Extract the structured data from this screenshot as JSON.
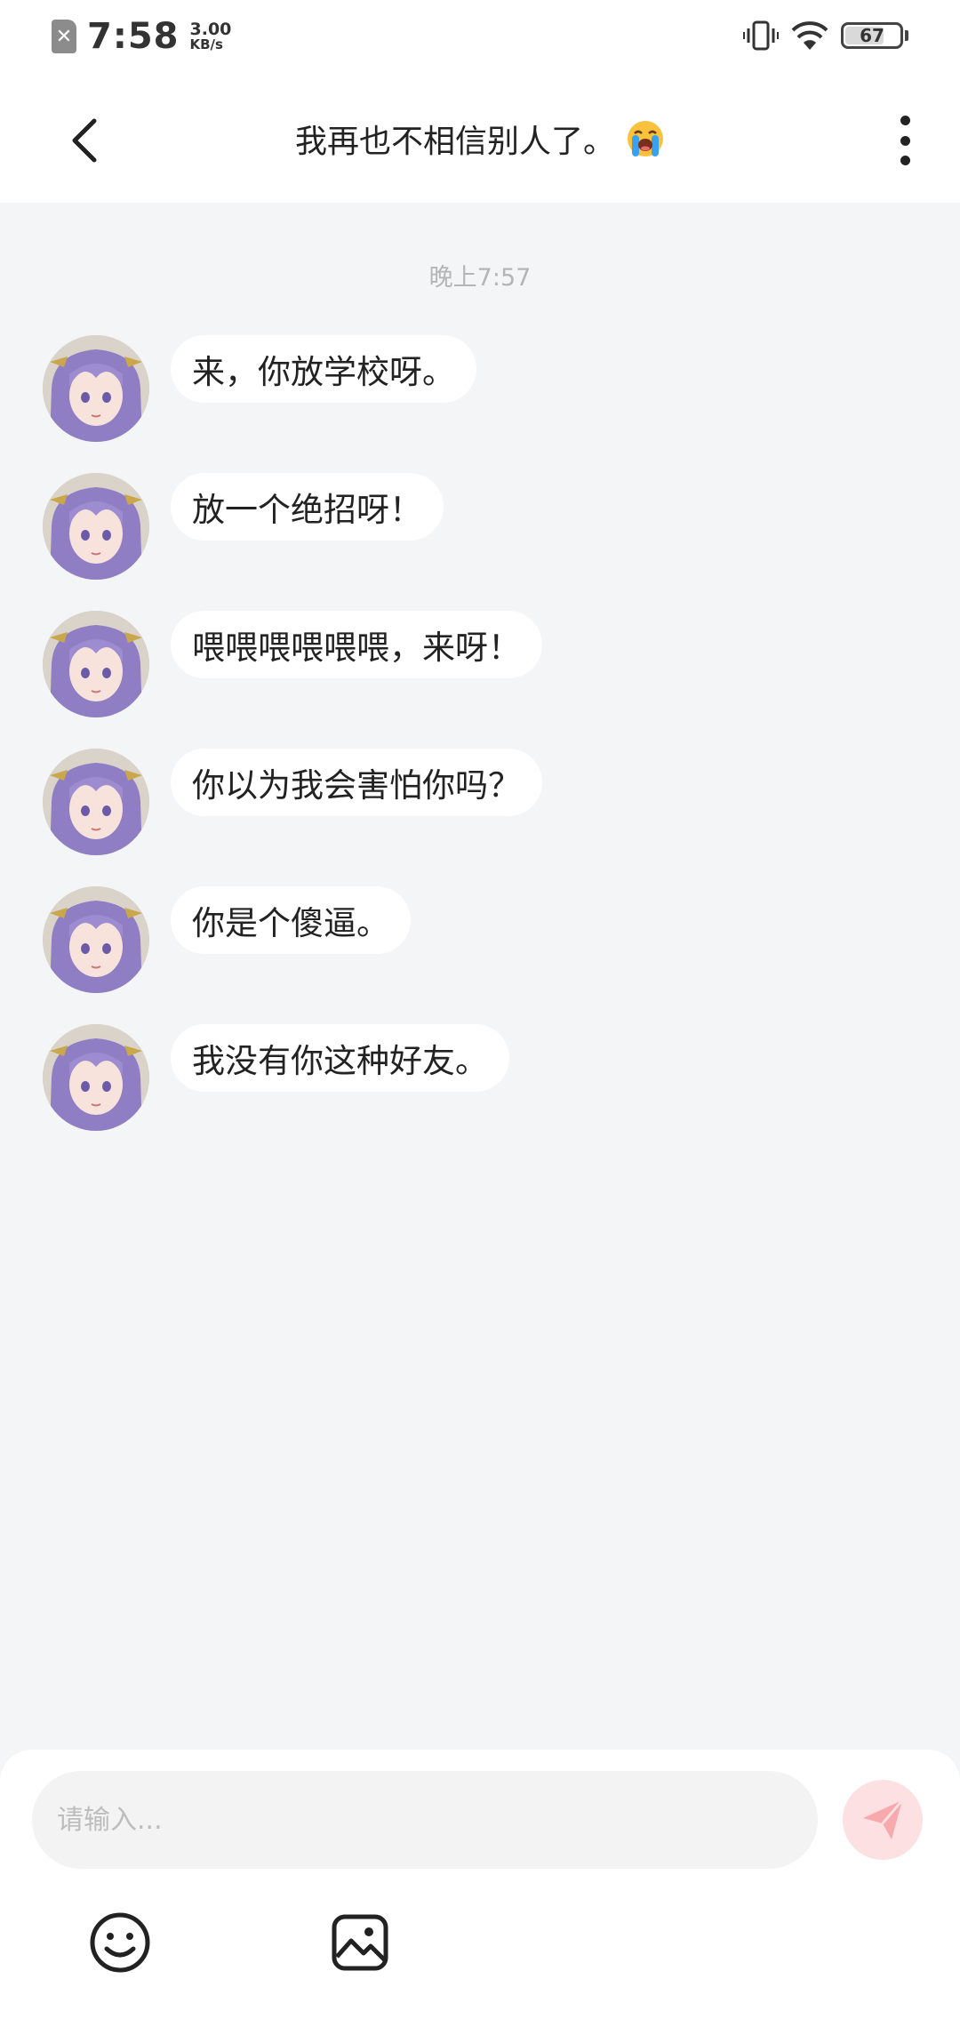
{
  "status_bar": {
    "time": "7:58",
    "net_speed_value": "3.00",
    "net_speed_unit": "KB/s",
    "battery": "67",
    "icons": [
      "no-sim-icon",
      "vibrate-icon",
      "wifi-icon",
      "battery-icon"
    ]
  },
  "header": {
    "title": "我再也不相信别人了。",
    "title_emoji": "loudly-crying-face-icon",
    "back_icon": "chevron-left-icon",
    "more_icon": "more-vertical-icon"
  },
  "chat": {
    "timestamp": "晚上7:57",
    "messages": [
      {
        "text": "来，你放学校呀。"
      },
      {
        "text": "放一个绝招呀！"
      },
      {
        "text": "喂喂喂喂喂喂，来呀！"
      },
      {
        "text": "你以为我会害怕你吗？"
      },
      {
        "text": "你是个傻逼。"
      },
      {
        "text": "我没有你这种好友。"
      }
    ]
  },
  "input": {
    "placeholder": "请输入..."
  },
  "toolbar": {
    "icons": [
      "emoji-icon",
      "image-icon",
      "send-icon"
    ]
  },
  "colors": {
    "background": "#f4f5f7",
    "bubble": "#ffffff",
    "send_button": "#fde0e1",
    "send_icon": "#f7a9ad",
    "timestamp": "#b5b5b5"
  }
}
